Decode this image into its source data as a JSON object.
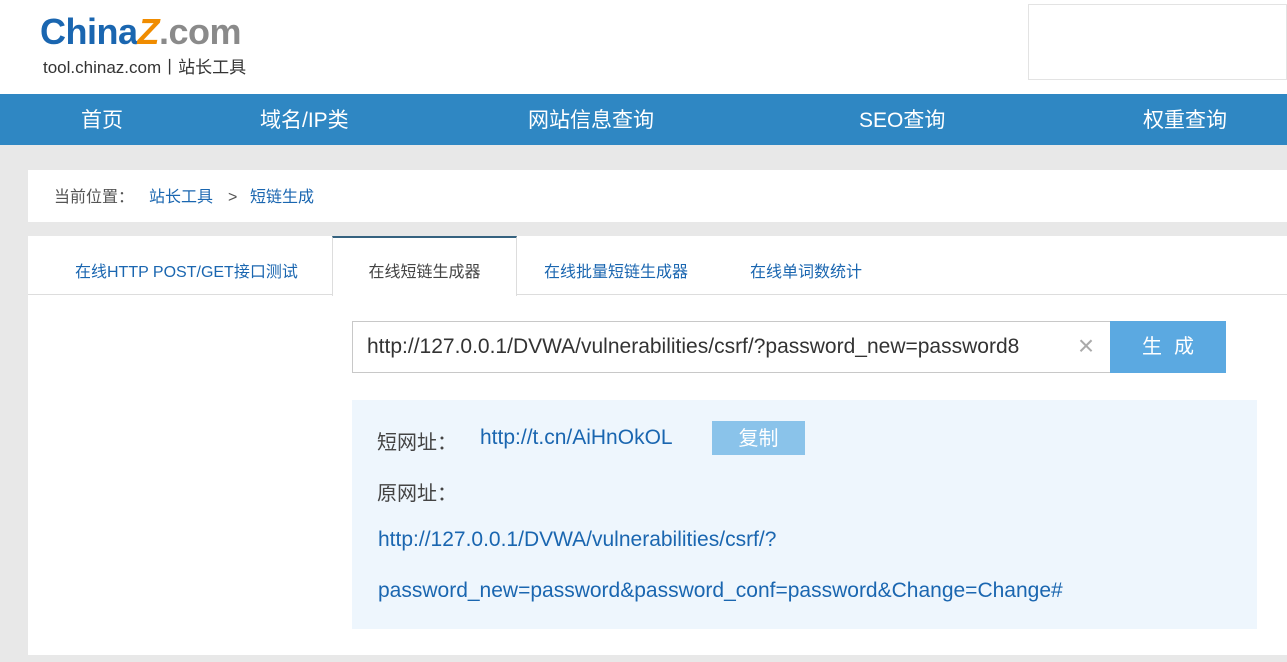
{
  "logo": {
    "part1": "China",
    "part2": "Z",
    "part3": ".com",
    "sub": "tool.chinaz.com丨站长工具"
  },
  "nav": {
    "items": [
      "首页",
      "域名/IP类",
      "网站信息查询",
      "SEO查询",
      "权重查询"
    ]
  },
  "breadcrumb": {
    "label": "当前位置：",
    "items": [
      "站长工具",
      "短链生成"
    ],
    "separator": ">"
  },
  "tabs": [
    "在线HTTP POST/GET接口测试",
    "在线短链生成器",
    "在线批量短链生成器",
    "在线单词数统计"
  ],
  "active_tab": "在线短链生成器",
  "input": {
    "value": "http://127.0.0.1/DVWA/vulnerabilities/csrf/?password_new=password8",
    "clear_icon": "×"
  },
  "generate_button": "生成",
  "result": {
    "short_label": "短网址：",
    "short_url": "http://t.cn/AiHnOkOL",
    "copy_button": "复制",
    "original_label": "原网址：",
    "original_url_line1": "http://127.0.0.1/DVWA/vulnerabilities/csrf/?",
    "original_url_line2": "password_new=password&password_conf=password&Change=Change#"
  },
  "colors": {
    "nav_bg": "#2f87c3",
    "link": "#1a66b0",
    "button": "#5ba9e1",
    "copy_button": "#8ac3ea",
    "result_bg": "#eef6fd"
  }
}
